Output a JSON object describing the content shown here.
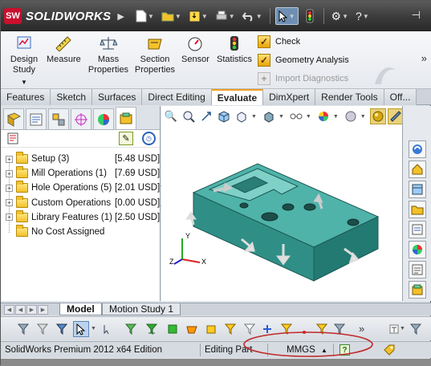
{
  "app": {
    "title": "SOLIDWORKS",
    "badge": "SW"
  },
  "ribbon": {
    "design_study": "Design Study",
    "measure": "Measure",
    "mass_properties": "Mass Properties",
    "section_properties": "Section Properties",
    "sensor": "Sensor",
    "statistics": "Statistics",
    "check": "Check",
    "geometry_analysis": "Geometry Analysis",
    "import_diagnostics": "Import Diagnostics"
  },
  "tabs": [
    {
      "label": "Features"
    },
    {
      "label": "Sketch"
    },
    {
      "label": "Surfaces"
    },
    {
      "label": "Direct Editing"
    },
    {
      "label": "Evaluate"
    },
    {
      "label": "DimXpert"
    },
    {
      "label": "Render Tools"
    },
    {
      "label": "Off..."
    }
  ],
  "tree": [
    {
      "label": "Setup (3)",
      "cost": "[5.48 USD]",
      "expandable": true
    },
    {
      "label": "Mill Operations (1)",
      "cost": "[7.69 USD]",
      "expandable": true
    },
    {
      "label": "Hole Operations (5)",
      "cost": "[2.01 USD]",
      "expandable": true
    },
    {
      "label": "Custom Operations",
      "cost": "[0.00 USD]",
      "expandable": true
    },
    {
      "label": "Library Features (1)",
      "cost": "[2.50 USD]",
      "expandable": true
    },
    {
      "label": "No Cost Assigned",
      "cost": "",
      "expandable": false
    }
  ],
  "triad": {
    "x": "X",
    "y": "Y",
    "z": "Z"
  },
  "bottom_tabs": {
    "model": "Model",
    "motion_study": "Motion Study 1"
  },
  "status": {
    "edition": "SolidWorks Premium 2012 x64 Edition",
    "mode": "Editing Part",
    "units": "MMGS",
    "units_arrow": "▲",
    "help": "?"
  },
  "colors": {
    "part_face": "#3aa39a",
    "accent_tab": "#f0a020",
    "annotation_ring": "#c0282a"
  }
}
